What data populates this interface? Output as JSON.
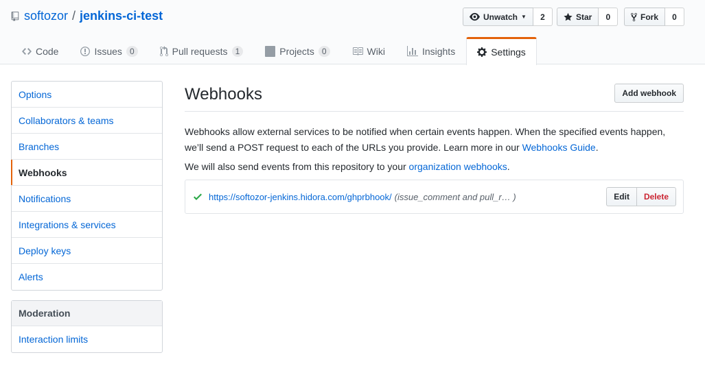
{
  "repo": {
    "owner": "softozor",
    "separator": "/",
    "name": "jenkins-ci-test"
  },
  "actions": {
    "watch": {
      "label": "Unwatch",
      "count": "2"
    },
    "star": {
      "label": "Star",
      "count": "0"
    },
    "fork": {
      "label": "Fork",
      "count": "0"
    }
  },
  "tabs": [
    {
      "label": "Code",
      "icon": "code-icon"
    },
    {
      "label": "Issues",
      "count": "0",
      "icon": "issue-icon"
    },
    {
      "label": "Pull requests",
      "count": "1",
      "icon": "pull-request-icon"
    },
    {
      "label": "Projects",
      "count": "0",
      "icon": "project-icon"
    },
    {
      "label": "Wiki",
      "icon": "wiki-icon"
    },
    {
      "label": "Insights",
      "icon": "graph-icon"
    },
    {
      "label": "Settings",
      "icon": "gear-icon",
      "selected": true
    }
  ],
  "sidebar": {
    "items": [
      {
        "label": "Options"
      },
      {
        "label": "Collaborators & teams"
      },
      {
        "label": "Branches"
      },
      {
        "label": "Webhooks",
        "selected": true
      },
      {
        "label": "Notifications"
      },
      {
        "label": "Integrations & services"
      },
      {
        "label": "Deploy keys"
      },
      {
        "label": "Alerts"
      }
    ],
    "moderation": {
      "heading": "Moderation",
      "items": [
        {
          "label": "Interaction limits"
        }
      ]
    }
  },
  "main": {
    "title": "Webhooks",
    "add_button": "Add webhook",
    "desc_part1": "Webhooks allow external services to be notified when certain events happen. When the specified events happen, we’ll send a POST request to each of the URLs you provide. Learn more in our ",
    "desc_link": "Webhooks Guide",
    "desc_part2": ".",
    "desc2_part1": "We will also send events from this repository to your ",
    "desc2_link": "organization webhooks",
    "desc2_part2": ".",
    "hooks": [
      {
        "status_icon": "check-icon",
        "url": "https://softozor-jenkins.hidora.com/ghprbhook/",
        "events": "(issue_comment and pull_r… )",
        "edit_label": "Edit",
        "delete_label": "Delete"
      }
    ]
  },
  "colors": {
    "accent": "#e36209",
    "link": "#0366d6",
    "success": "#28a745",
    "danger": "#cb2431"
  }
}
